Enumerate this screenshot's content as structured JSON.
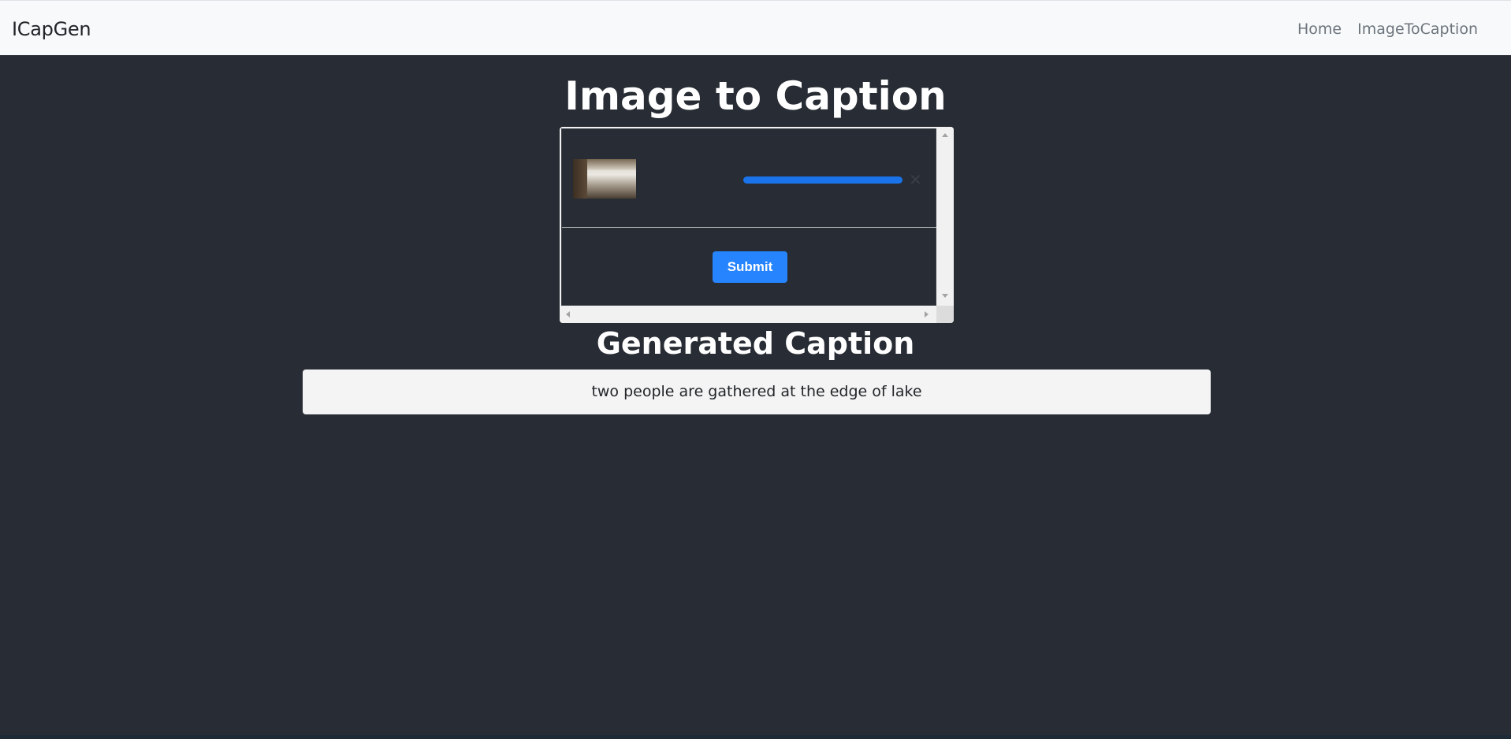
{
  "navbar": {
    "brand": "ICapGen",
    "links": [
      "Home",
      "ImageToCaption"
    ]
  },
  "main": {
    "title": "Image to Caption",
    "upload": {
      "progress_percent": 100,
      "submit_label": "Submit",
      "remove_symbol": "✕"
    },
    "caption_heading": "Generated Caption",
    "caption_text": "two people are gathered at the edge of lake"
  },
  "colors": {
    "background": "#282c34",
    "navbar": "#f8f9fa",
    "accent": "#2684ff",
    "progress": "#1a73e8"
  }
}
